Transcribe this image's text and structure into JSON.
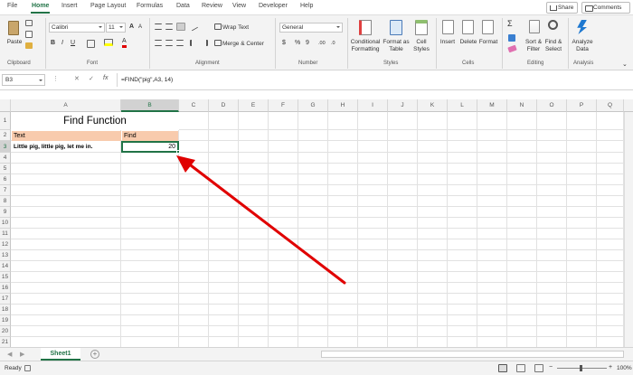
{
  "tabs": [
    "File",
    "Home",
    "Insert",
    "Page Layout",
    "Formulas",
    "Data",
    "Review",
    "View",
    "Developer",
    "Help"
  ],
  "share_label": "Share",
  "comments_label": "Comments",
  "ribbon": {
    "clipboard": {
      "paste": "Paste",
      "group": "Clipboard"
    },
    "font": {
      "name": "Calibri",
      "size": "11",
      "group": "Font"
    },
    "alignment": {
      "wrap": "Wrap Text",
      "merge": "Merge & Center",
      "group": "Alignment"
    },
    "number": {
      "format": "General",
      "currency": "$",
      "percent": "%",
      "comma": "9",
      "dec_inc": ".00",
      "dec_dec": ".0",
      "group": "Number"
    },
    "styles": {
      "conditional": "Conditional Formatting",
      "format_table": "Format as Table",
      "cell_styles": "Cell Styles",
      "group": "Styles"
    },
    "cells": {
      "insert": "Insert",
      "delete": "Delete",
      "format": "Format",
      "group": "Cells"
    },
    "editing": {
      "sort": "Sort & Filter",
      "find": "Find & Select",
      "group": "Editing"
    },
    "analysis": {
      "analyze": "Analyze Data",
      "group": "Analysis"
    }
  },
  "formula_bar": {
    "name_box": "B3",
    "fx": "fx",
    "formula": "=FIND(\"pig\",A3, 14)"
  },
  "columns": [
    "A",
    "B",
    "C",
    "D",
    "E",
    "F",
    "G",
    "H",
    "I",
    "J",
    "K",
    "L",
    "M",
    "N",
    "O",
    "P",
    "Q"
  ],
  "rows": [
    "1",
    "2",
    "3",
    "4",
    "5",
    "6",
    "7",
    "8",
    "9",
    "10",
    "11",
    "12",
    "13",
    "14",
    "15",
    "16",
    "17",
    "18",
    "19",
    "20",
    "21"
  ],
  "cells": {
    "title": "Find Function",
    "header_text": "Text",
    "header_find": "Find",
    "a3": "Little pig, little pig, let me in.",
    "b3": "20"
  },
  "colors": {
    "accent": "#217346",
    "header_fill": "#f8cbad",
    "arrow": "#e00000"
  },
  "sheet": {
    "name": "Sheet1",
    "add": "+"
  },
  "status": {
    "ready": "Ready",
    "zoom": "100%"
  }
}
